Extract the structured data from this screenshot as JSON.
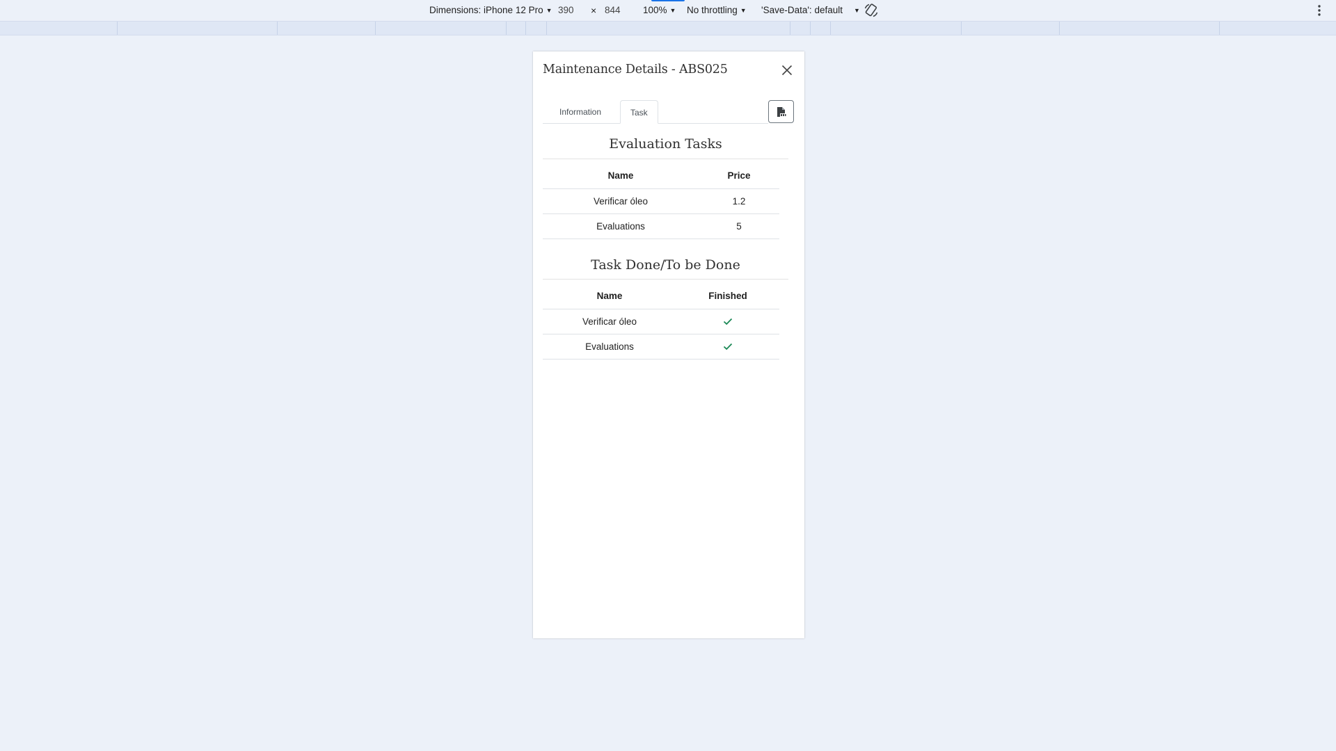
{
  "devtools": {
    "device_label": "Dimensions: iPhone 12 Pro",
    "width_value": "390",
    "times": "×",
    "height_value": "844",
    "zoom": "100%",
    "throttling": "No throttling",
    "save_data": "'Save-Data': default"
  },
  "modal": {
    "title": "Maintenance Details - ABS025",
    "tabs": [
      {
        "label": "Information",
        "active": false
      },
      {
        "label": "Task",
        "active": true
      }
    ]
  },
  "evaluation": {
    "title": "Evaluation Tasks",
    "headers": [
      "Name",
      "Price"
    ],
    "rows": [
      [
        "Verificar óleo",
        "1.2"
      ],
      [
        "Evaluations",
        "5"
      ]
    ]
  },
  "tasks": {
    "title": "Task Done/To be Done",
    "headers": [
      "Name",
      "Finished"
    ],
    "rows": [
      {
        "name": "Verificar óleo",
        "finished": true
      },
      {
        "name": "Evaluations",
        "finished": true
      }
    ]
  },
  "colors": {
    "check": "#198754",
    "page_bg": "#ecf1f9",
    "accent": "#1a73e8"
  },
  "icons": {
    "close": "close-icon",
    "pdf": "pdf-file-icon",
    "rotate": "rotate-icon",
    "check": "check-icon",
    "more": "more-vert-icon"
  }
}
